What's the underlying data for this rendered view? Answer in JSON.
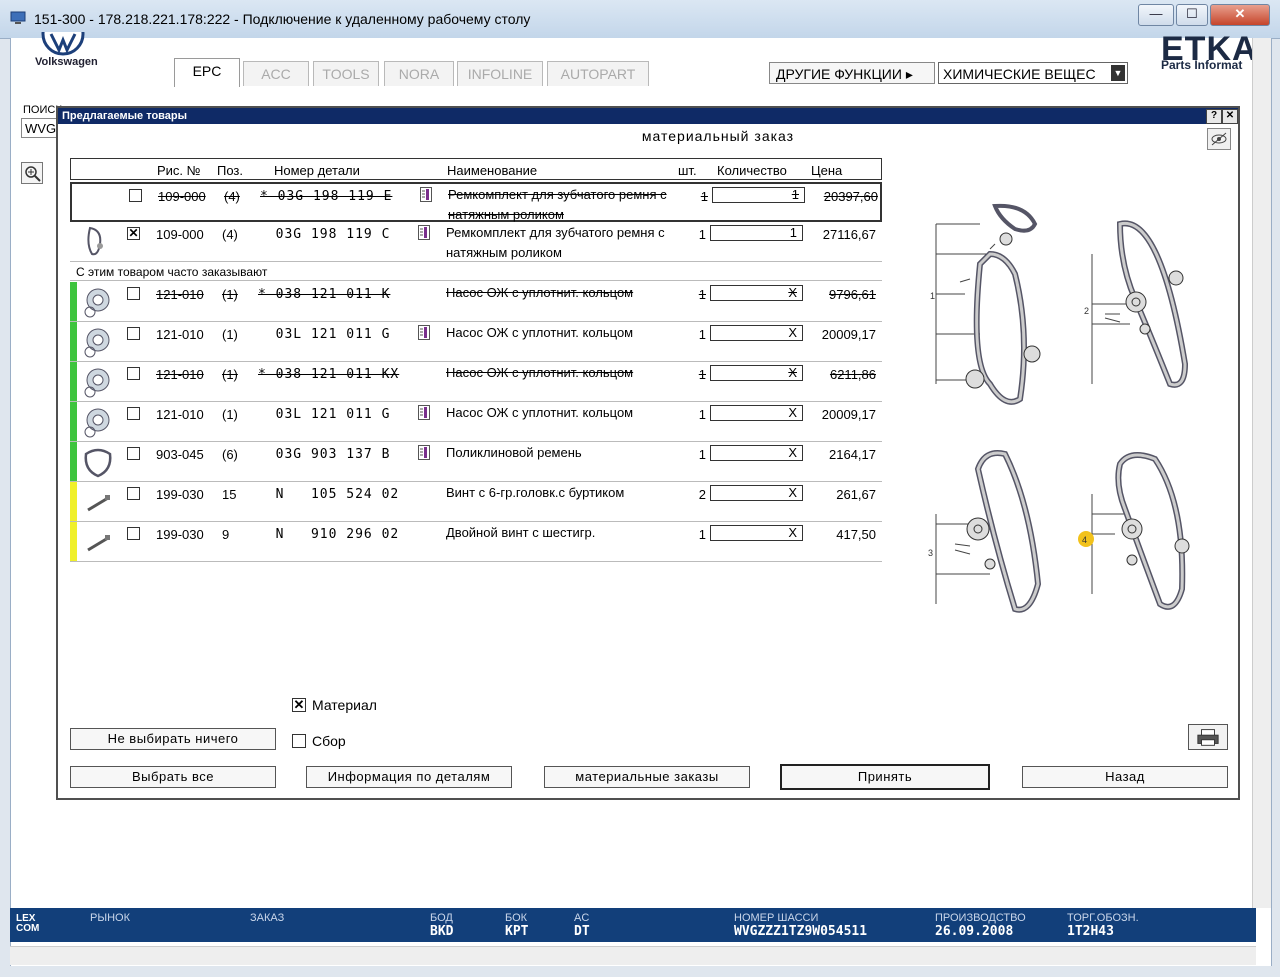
{
  "window": {
    "title": "151-300 - 178.218.221.178:222 - Подключение к удаленному рабочему столу",
    "min": "—",
    "max": "☐",
    "close": "✕"
  },
  "app": {
    "brand": "Volkswagen",
    "logo_text": "ETKA",
    "logo_sub": "Parts Informat",
    "tabs": [
      "EPC",
      "ACC",
      "TOOLS",
      "NORA",
      "INFOLINE",
      "AUTOPART"
    ],
    "other_functions": "ДРУГИЕ ФУНКЦИИ ▸",
    "chem_select": "ХИМИЧЕСКИЕ ВЕЩЕС",
    "search_label": "ПОИСК",
    "search_value": "WVG"
  },
  "dialog": {
    "title": "Предлагаемые товары",
    "help": "?",
    "close": "✕",
    "order_title": "материальный заказ",
    "columns": [
      "Рис. №",
      "Поз.",
      "Номер детали",
      "Наименование",
      "шт.",
      "Количество",
      "Цена"
    ],
    "section_label": "С этим товаром часто заказывают",
    "rows": [
      {
        "bar": "",
        "checked": "",
        "fig": "109-000",
        "pos": "(4)",
        "pn": "* 03G 198 119 E",
        "info": true,
        "name": "Ремкомплект для зубчатого ремня с натяжным роликом",
        "qty": "1",
        "qbox": "1",
        "price": "20397,60",
        "struck": true,
        "selected": true
      },
      {
        "bar": "",
        "checked": "✕",
        "fig": "109-000",
        "pos": "(4)",
        "pn": "  03G 198 119 C",
        "info": true,
        "name": "Ремкомплект для зубчатого ремня с натяжным роликом",
        "qty": "1",
        "qbox": "1",
        "price": "27116,67",
        "struck": false,
        "selected": false
      },
      {
        "bar": "#3ec43e",
        "checked": "",
        "fig": "121-010",
        "pos": "(1)",
        "pn": "* 038 121 011 K",
        "info": false,
        "name": "Насос ОЖ с уплотнит. кольцом",
        "qty": "1",
        "qbox": "X",
        "price": "9796,61",
        "struck": true,
        "selected": false
      },
      {
        "bar": "#3ec43e",
        "checked": "",
        "fig": "121-010",
        "pos": "(1)",
        "pn": "  03L 121 011 G",
        "info": true,
        "name": "Насос ОЖ с уплотнит. кольцом",
        "qty": "1",
        "qbox": "X",
        "price": "20009,17",
        "struck": false,
        "selected": false
      },
      {
        "bar": "#3ec43e",
        "checked": "",
        "fig": "121-010",
        "pos": "(1)",
        "pn": "* 038 121 011 KX",
        "info": false,
        "name": "Насос ОЖ с уплотнит. кольцом",
        "qty": "1",
        "qbox": "X",
        "price": "6211,86",
        "struck": true,
        "selected": false
      },
      {
        "bar": "#3ec43e",
        "checked": "",
        "fig": "121-010",
        "pos": "(1)",
        "pn": "  03L 121 011 G",
        "info": true,
        "name": "Насос ОЖ с уплотнит. кольцом",
        "qty": "1",
        "qbox": "X",
        "price": "20009,17",
        "struck": false,
        "selected": false
      },
      {
        "bar": "#3ec43e",
        "checked": "",
        "fig": "903-045",
        "pos": "(6)",
        "pn": "  03G 903 137 B",
        "info": true,
        "name": "Поликлиновой ремень",
        "qty": "1",
        "qbox": "X",
        "price": "2164,17",
        "struck": false,
        "selected": false
      },
      {
        "bar": "#f0f02a",
        "checked": "",
        "fig": "199-030",
        "pos": "15",
        "pn": "  N   105 524 02",
        "info": false,
        "name": "Винт с 6-гр.головк.с буртиком",
        "qty": "2",
        "qbox": "X",
        "price": "261,67",
        "struck": false,
        "selected": false
      },
      {
        "bar": "#f0f02a",
        "checked": "",
        "fig": "199-030",
        "pos": "9",
        "pn": "  N   910 296 02",
        "info": false,
        "name": "Двойной винт с шестигр.",
        "qty": "1",
        "qbox": "X",
        "price": "417,50",
        "struck": false,
        "selected": false
      }
    ],
    "checkboxes": {
      "material": {
        "label": "Материал",
        "checked": "✕"
      },
      "sbor": {
        "label": "Сбор",
        "checked": ""
      }
    },
    "buttons": {
      "select_none": "Не выбирать ничего",
      "select_all": "Выбрать все",
      "info": "Информация по деталям",
      "orders": "материальные заказы",
      "accept": "Принять",
      "back": "Назад"
    },
    "diagram_labels": [
      "1",
      "2",
      "3",
      "4"
    ]
  },
  "status": {
    "market_label": "РЫНОК",
    "order_label": "ЗАКАЗ",
    "bod_label": "БОД",
    "bod": "BKD",
    "bok_label": "БОК",
    "bok": "KPT",
    "ac_label": "AC",
    "ac": "DT",
    "chassis_label": "НОМЕР ШАССИ",
    "chassis": "WVGZZZ1TZ9W054511",
    "prod_label": "ПРОИЗВОДСТВО",
    "prod": "26.09.2008",
    "torg_label": "ТОРГ.ОБОЗН.",
    "torg": "1T2H43",
    "lexcom": "LEX\nCOM"
  },
  "colors": {
    "titlebar": "#c3d6ea",
    "dialog_title": "#0f2a66",
    "status": "#123f7a",
    "green": "#3ec43e",
    "yellow": "#f0f02a"
  }
}
